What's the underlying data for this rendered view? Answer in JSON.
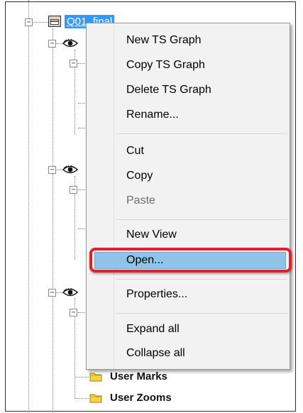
{
  "tree": {
    "root_label": "Q01_final",
    "expander_collapsed_symbol": "−",
    "folders": [
      {
        "label": "User Marks"
      },
      {
        "label": "User Zooms"
      }
    ]
  },
  "context_menu": {
    "groups": [
      [
        "New TS Graph",
        "Copy TS Graph",
        "Delete TS Graph",
        "Rename..."
      ],
      [
        "Cut",
        "Copy",
        "Paste"
      ],
      [
        "New View",
        "Open..."
      ],
      [
        "Properties..."
      ],
      [
        "Expand all",
        "Collapse all"
      ]
    ],
    "items": {
      "new_ts_graph": "New TS Graph",
      "copy_ts_graph": "Copy TS Graph",
      "delete_ts_graph": "Delete TS Graph",
      "rename": "Rename...",
      "cut": "Cut",
      "copy": "Copy",
      "paste": "Paste",
      "new_view": "New View",
      "open": "Open...",
      "properties": "Properties...",
      "expand_all": "Expand all",
      "collapse_all": "Collapse all"
    },
    "disabled_items": [
      "Paste"
    ],
    "highlighted_item": "Open..."
  },
  "colors": {
    "selection_blue": "#3399ff",
    "highlight_item_fill": "#8fc3e8",
    "annotation_red": "#e3202a",
    "menu_background": "#f2f2f2"
  },
  "icons": {
    "root": "graph-icon",
    "view": "eye-icon",
    "folder": "folder-icon"
  }
}
